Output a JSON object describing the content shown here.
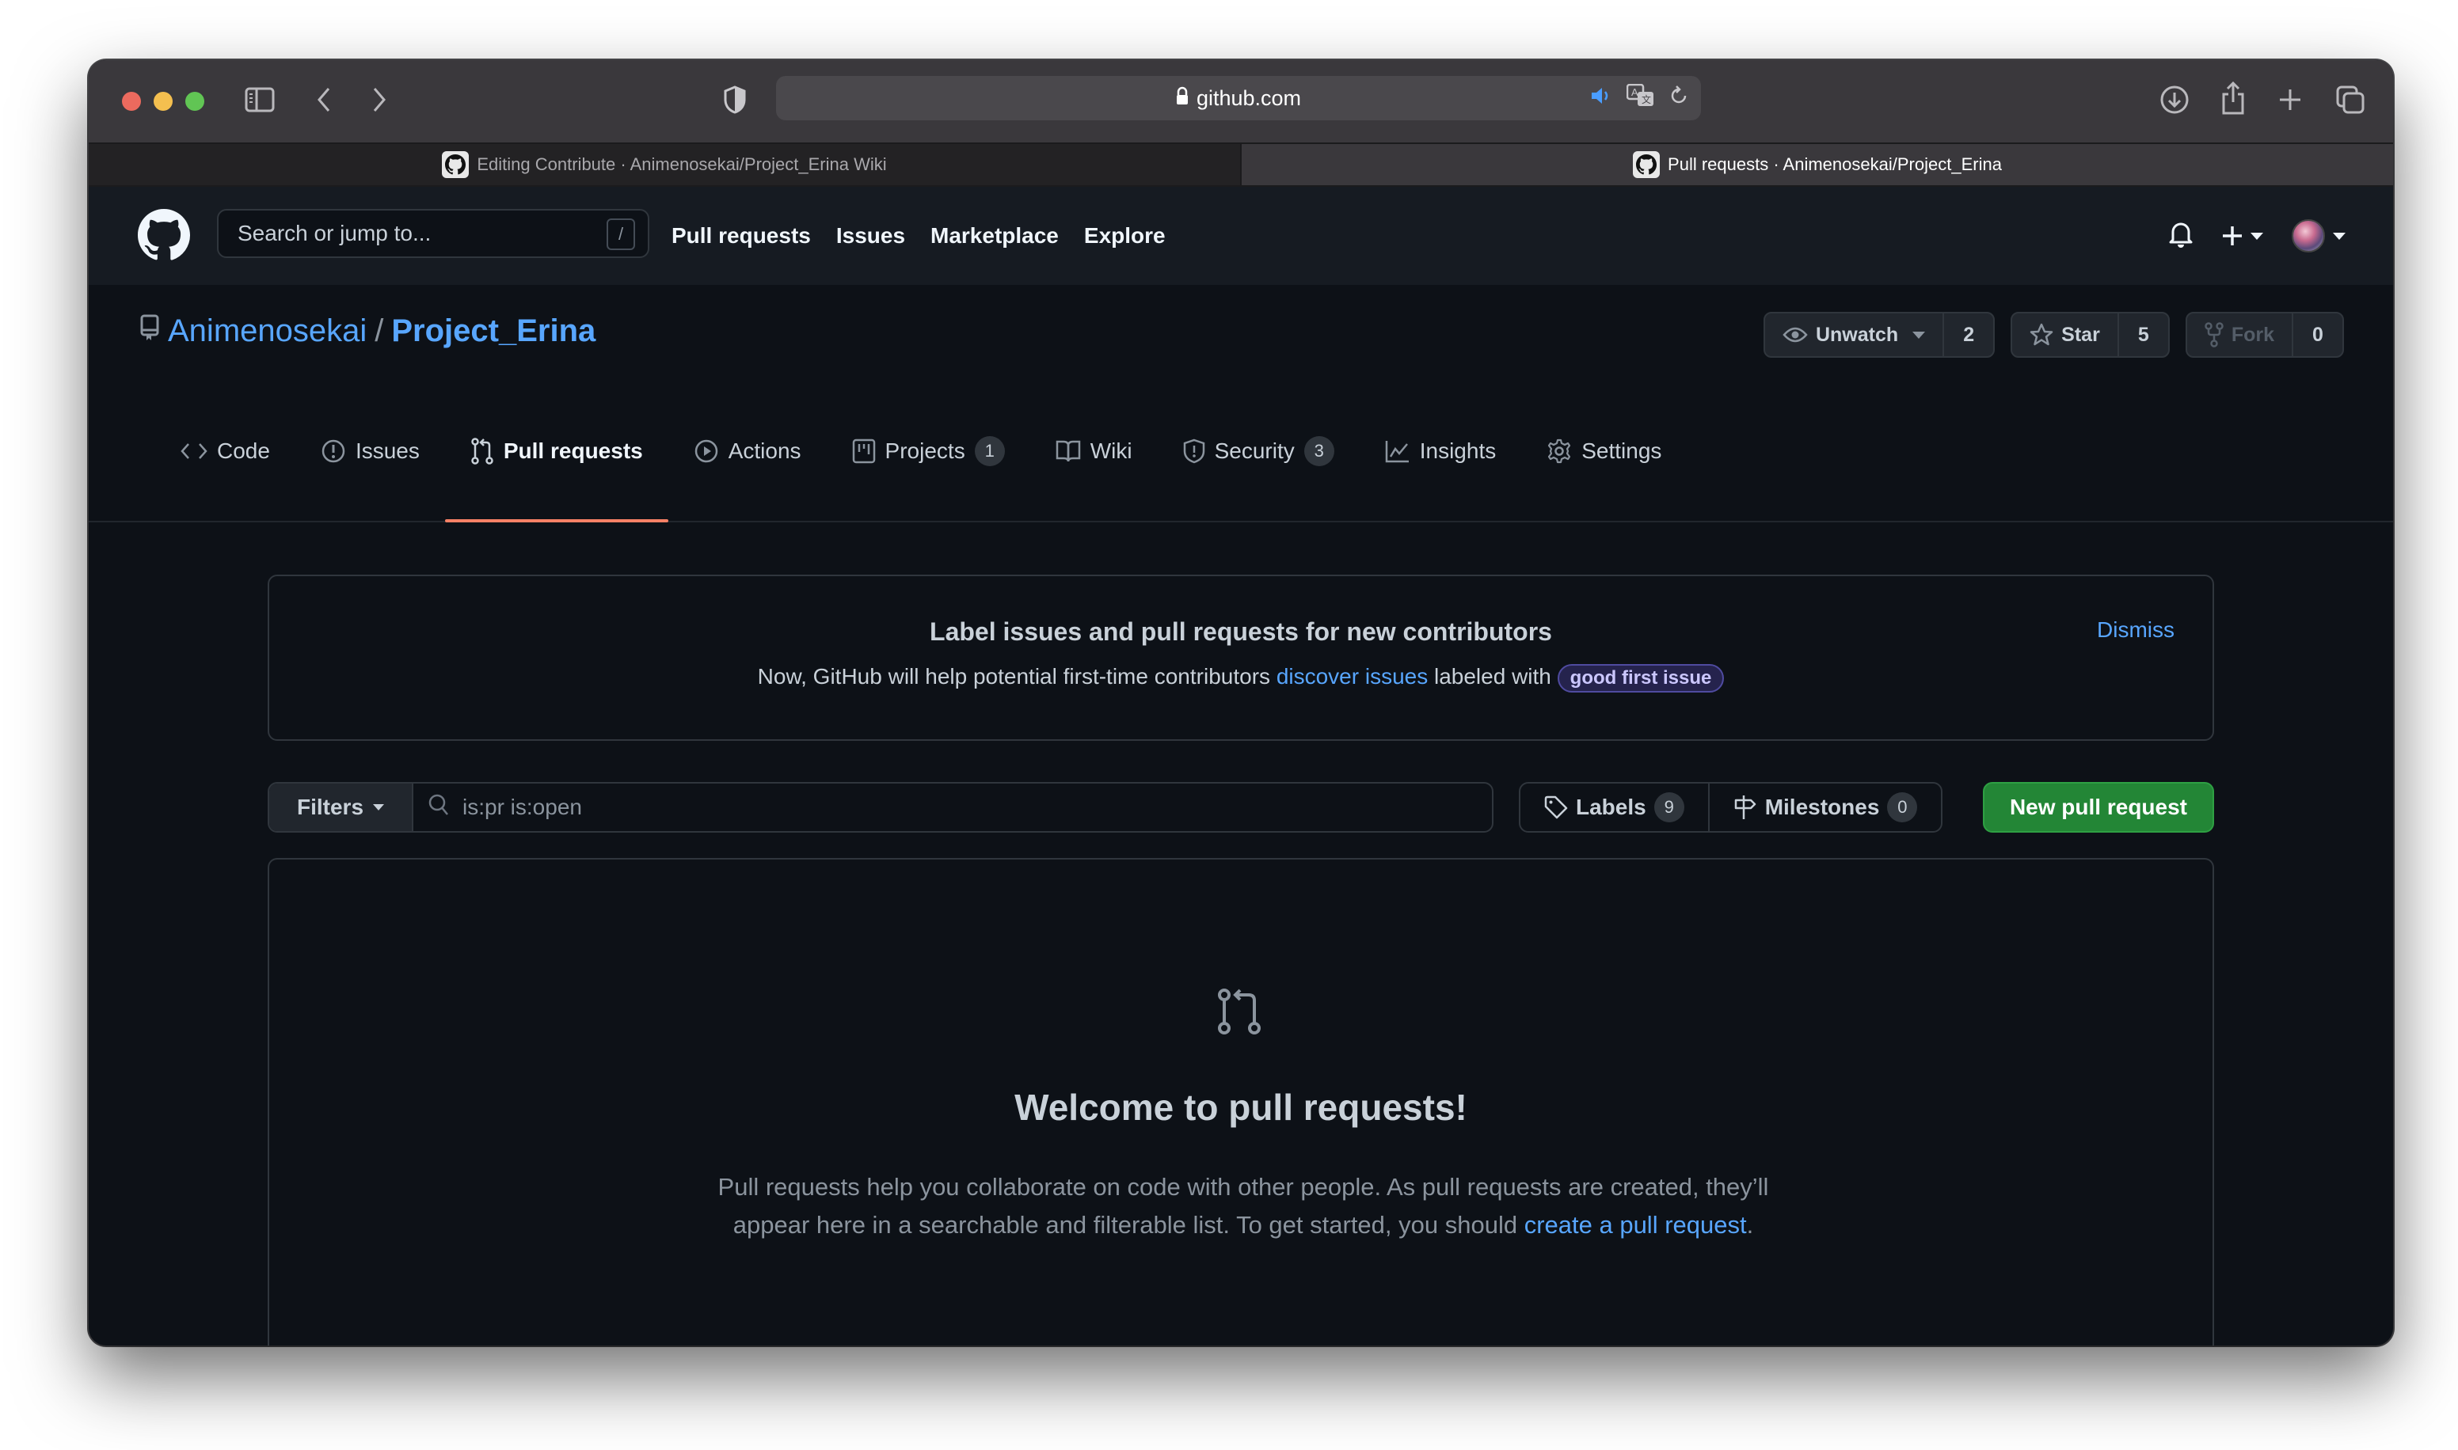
{
  "browser": {
    "url": "github.com",
    "tabs": [
      {
        "title": "Editing Contribute · Animenosekai/Project_Erina Wiki",
        "active": false
      },
      {
        "title": "Pull requests · Animenosekai/Project_Erina",
        "active": true
      }
    ]
  },
  "header": {
    "search_placeholder": "Search or jump to...",
    "search_shortcut": "/",
    "nav": [
      "Pull requests",
      "Issues",
      "Marketplace",
      "Explore"
    ]
  },
  "repo": {
    "owner": "Animenosekai",
    "separator": "/",
    "name": "Project_Erina",
    "watch": {
      "label": "Unwatch",
      "count": "2"
    },
    "star": {
      "label": "Star",
      "count": "5"
    },
    "fork": {
      "label": "Fork",
      "count": "0"
    },
    "tabs": [
      {
        "label": "Code",
        "icon": "code-icon"
      },
      {
        "label": "Issues",
        "icon": "issue-icon"
      },
      {
        "label": "Pull requests",
        "icon": "pull-request-icon",
        "selected": true
      },
      {
        "label": "Actions",
        "icon": "play-icon"
      },
      {
        "label": "Projects",
        "icon": "project-icon",
        "count": "1"
      },
      {
        "label": "Wiki",
        "icon": "book-icon"
      },
      {
        "label": "Security",
        "icon": "shield-icon",
        "count": "3"
      },
      {
        "label": "Insights",
        "icon": "graph-icon"
      },
      {
        "label": "Settings",
        "icon": "gear-icon"
      }
    ]
  },
  "banner": {
    "title": "Label issues and pull requests for new contributors",
    "text_before": "Now, GitHub will help potential first-time contributors ",
    "link": "discover issues",
    "text_after": " labeled with ",
    "label": "good first issue",
    "dismiss": "Dismiss"
  },
  "filters": {
    "button": "Filters",
    "query": "is:pr is:open",
    "labels": {
      "label": "Labels",
      "count": "9"
    },
    "milestones": {
      "label": "Milestones",
      "count": "0"
    },
    "new_pr": "New pull request"
  },
  "blank_slate": {
    "title": "Welcome to pull requests!",
    "text": "Pull requests help you collaborate on code with other people. As pull requests are created, they’ll appear here in a searchable and filterable list. To get started, you should ",
    "link": "create a pull request",
    "end": "."
  },
  "colors": {
    "accent_link": "#58a6ff",
    "primary_button": "#238636",
    "selected_tab_underline": "#f78166"
  }
}
